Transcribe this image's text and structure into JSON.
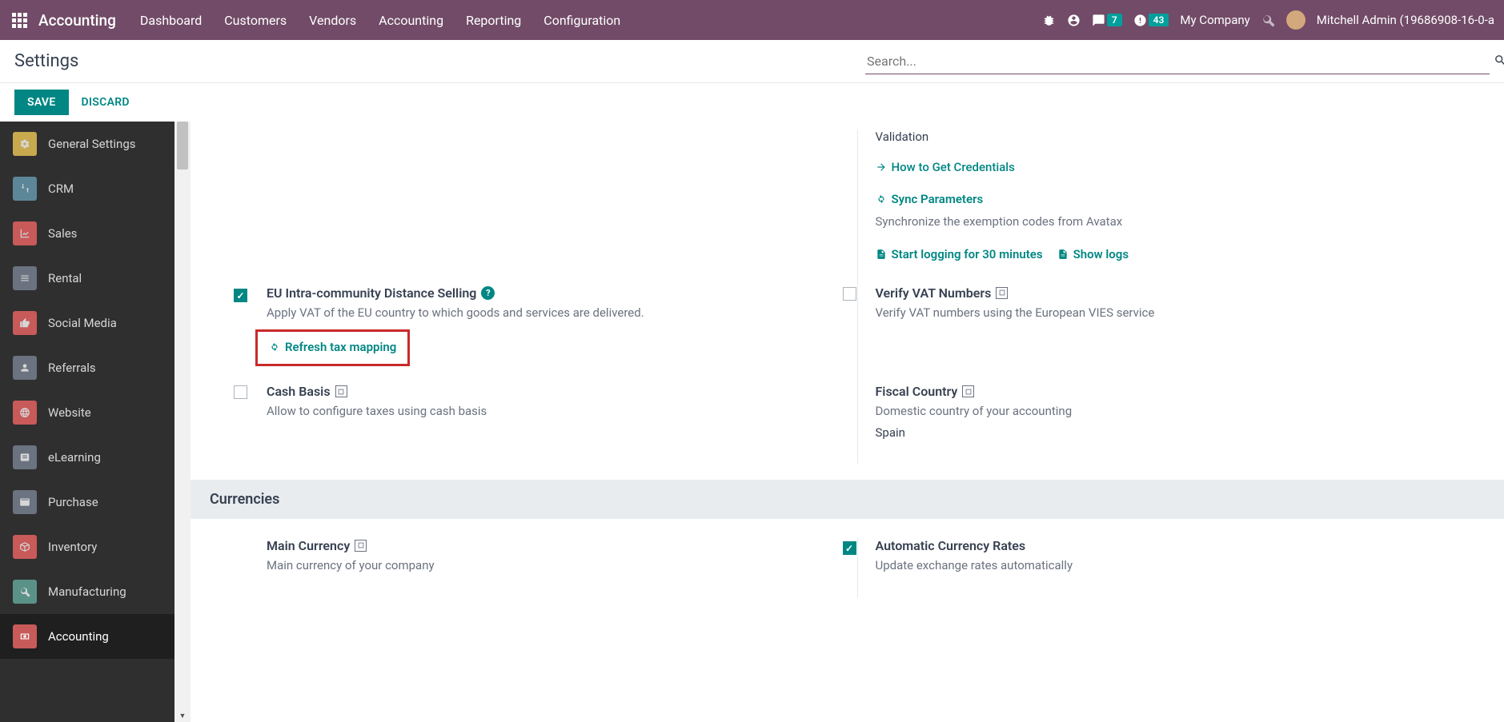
{
  "topnav": {
    "brand": "Accounting",
    "links": [
      "Dashboard",
      "Customers",
      "Vendors",
      "Accounting",
      "Reporting",
      "Configuration"
    ],
    "badge_msg": "7",
    "badge_clock": "43",
    "company": "My Company",
    "user": "Mitchell Admin (19686908-16-0-a"
  },
  "page": {
    "title": "Settings",
    "save": "SAVE",
    "discard": "DISCARD",
    "search_placeholder": "Search..."
  },
  "sidebar": [
    {
      "label": "General Settings"
    },
    {
      "label": "CRM"
    },
    {
      "label": "Sales"
    },
    {
      "label": "Rental"
    },
    {
      "label": "Social Media"
    },
    {
      "label": "Referrals"
    },
    {
      "label": "Website"
    },
    {
      "label": "eLearning"
    },
    {
      "label": "Purchase"
    },
    {
      "label": "Inventory"
    },
    {
      "label": "Manufacturing"
    },
    {
      "label": "Accounting"
    }
  ],
  "right_col": {
    "validation": "Validation",
    "how_to": "How to Get Credentials",
    "sync_title": "Sync Parameters",
    "sync_desc": "Synchronize the exemption codes from Avatax",
    "start_log": "Start logging for 30 minutes",
    "show_logs": "Show logs",
    "vat_title": "Verify VAT Numbers",
    "vat_desc": "Verify VAT numbers using the European VIES service",
    "fiscal_title": "Fiscal Country",
    "fiscal_desc": "Domestic country of your accounting",
    "fiscal_value": "Spain",
    "auto_rates_title": "Automatic Currency Rates",
    "auto_rates_desc": "Update exchange rates automatically"
  },
  "left_col": {
    "eu_title": "EU Intra-community Distance Selling",
    "eu_desc": "Apply VAT of the EU country to which goods and services are delivered.",
    "refresh": "Refresh tax mapping",
    "cash_title": "Cash Basis",
    "cash_desc": "Allow to configure taxes using cash basis",
    "main_curr_title": "Main Currency",
    "main_curr_desc": "Main currency of your company"
  },
  "sections": {
    "currencies": "Currencies"
  }
}
